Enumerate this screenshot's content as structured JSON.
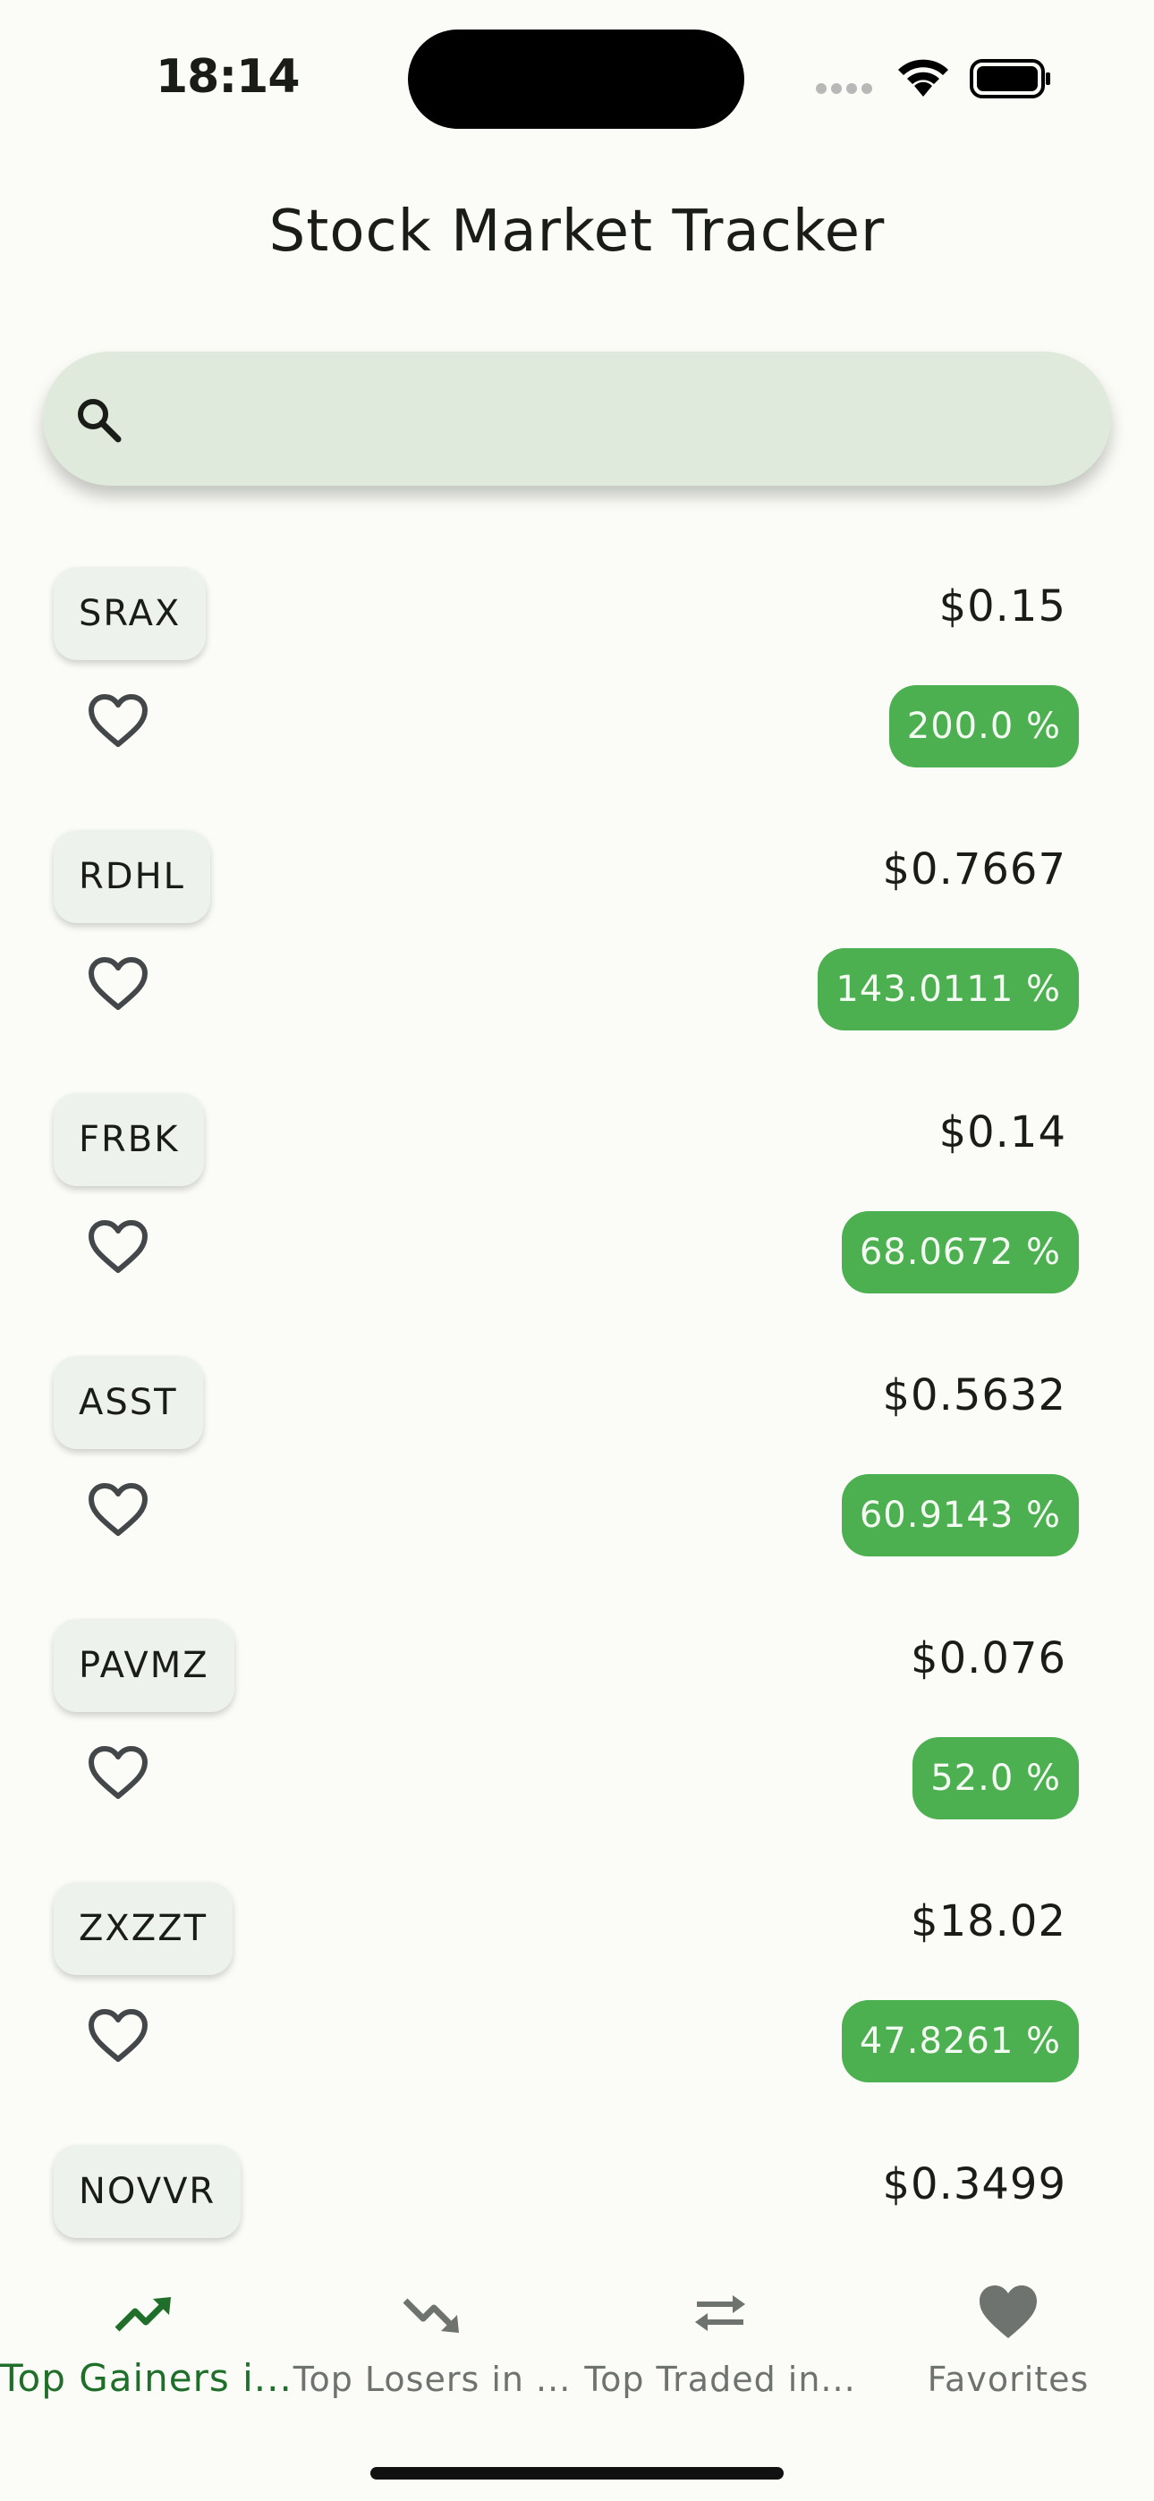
{
  "status_bar": {
    "time": "18:14"
  },
  "header": {
    "title": "Stock Market Tracker"
  },
  "search": {
    "placeholder": "",
    "value": ""
  },
  "stocks": [
    {
      "symbol": "SRAX",
      "price": "$0.15",
      "change": "200.0 %"
    },
    {
      "symbol": "RDHL",
      "price": "$0.7667",
      "change": "143.0111 %"
    },
    {
      "symbol": "FRBK",
      "price": "$0.14",
      "change": "68.0672 %"
    },
    {
      "symbol": "ASST",
      "price": "$0.5632",
      "change": "60.9143 %"
    },
    {
      "symbol": "PAVMZ",
      "price": "$0.076",
      "change": "52.0 %"
    },
    {
      "symbol": "ZXZZT",
      "price": "$18.02",
      "change": "47.8261 %"
    },
    {
      "symbol": "NOVVR",
      "price": "$0.3499",
      "change": ""
    }
  ],
  "bottom_nav": {
    "items": [
      {
        "label": "Top Gainers i...",
        "icon": "trending-up-icon",
        "active": true
      },
      {
        "label": "Top Losers in ...",
        "icon": "trending-down-icon",
        "active": false
      },
      {
        "label": "Top Traded in...",
        "icon": "swap-icon",
        "active": false
      },
      {
        "label": "Favorites",
        "icon": "heart-icon",
        "active": false
      }
    ]
  },
  "colors": {
    "background": "#fbfcf7",
    "search_bg": "#dfe9dc",
    "gain_badge": "#4caf50",
    "active_nav": "#1f6f2a",
    "inactive_nav": "#6f7370"
  }
}
